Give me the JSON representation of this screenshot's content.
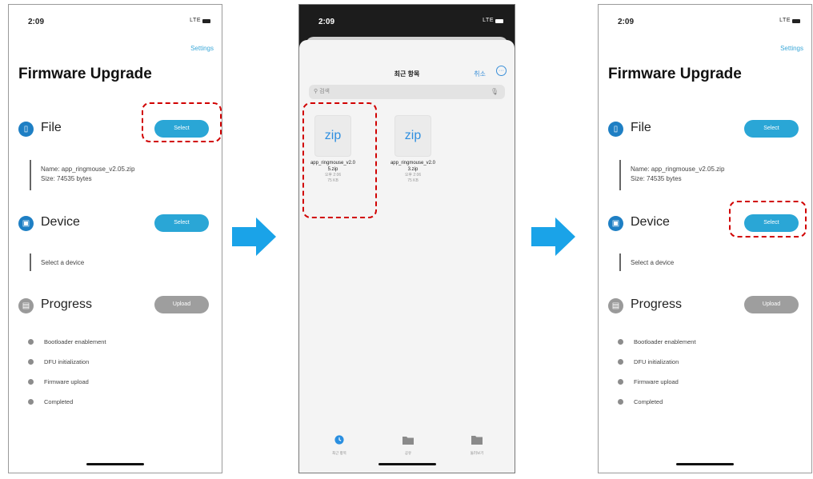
{
  "status_bar": {
    "time": "2:09",
    "signal": "LTE"
  },
  "firmware": {
    "settings": "Settings",
    "title": "Firmware Upgrade",
    "file_label": "File",
    "device_label": "Device",
    "progress_label": "Progress",
    "select_btn": "Select",
    "upload_btn": "Upload",
    "file_name": "Name: app_ringmouse_v2.05.zip",
    "file_size": "Size: 74535 bytes",
    "device_hint": "Select a device",
    "steps": [
      "Bootloader enablement",
      "DFU initialization",
      "Firmware upload",
      "Completed"
    ]
  },
  "picker": {
    "title": "최근 항목",
    "cancel": "취소",
    "search_placeholder": "검색",
    "files": [
      {
        "ext": "zip",
        "name": "app_ringmouse_v2.05.zip",
        "sub1": "오후 2:06",
        "sub2": "75 KB"
      },
      {
        "ext": "zip",
        "name": "app_ringmouse_v2.03.zip",
        "sub1": "오후 2:06",
        "sub2": "75 KB"
      }
    ],
    "tabs": [
      "최근 항목",
      "공유",
      "둘러보기"
    ]
  },
  "colors": {
    "accent": "#2aa6d6",
    "section_icon": "#1e7fc4",
    "callout": "#d10000",
    "arrow": "#1aa3e8"
  }
}
